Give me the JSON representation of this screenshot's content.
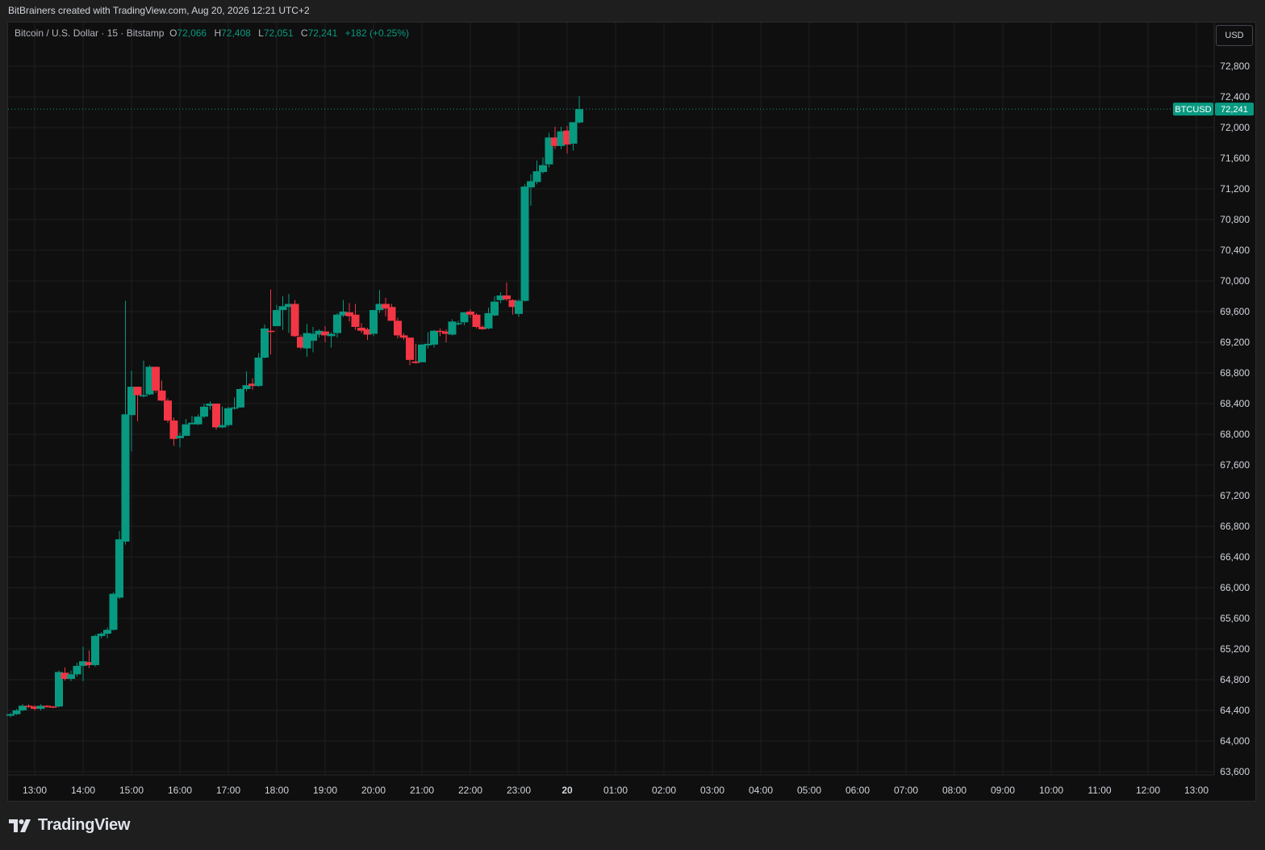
{
  "attribution": "BitBrainers created with TradingView.com, Aug 20, 2026 12:21 UTC+2",
  "legend": {
    "symbol": "Bitcoin / U.S. Dollar · 15 · Bitstamp",
    "open_label": "O",
    "open": "72,066",
    "high_label": "H",
    "high": "72,408",
    "low_label": "L",
    "low": "72,051",
    "close_label": "C",
    "close": "72,241",
    "change": "+182 (+0.25%)"
  },
  "currency_button": "USD",
  "price_tag": {
    "symbol": "BTCUSD",
    "price": "72,241"
  },
  "footer": {
    "logo_text": "TradingView",
    "logo_icon": "tradingview-logo-icon"
  },
  "colors": {
    "up": "#089981",
    "down": "#f23645",
    "background": "#0f0f0f",
    "grid": "#1f1f1f",
    "text": "#d1d4dc"
  },
  "chart_data": {
    "type": "candlestick",
    "interval": "15",
    "ylim": [
      63600,
      73200
    ],
    "y_ticks": [
      "72,800",
      "72,400",
      "72,000",
      "71,600",
      "71,200",
      "70,800",
      "70,400",
      "70,000",
      "69,600",
      "69,200",
      "68,800",
      "68,400",
      "68,000",
      "67,600",
      "67,200",
      "66,800",
      "66,400",
      "66,000",
      "65,600",
      "65,200",
      "64,800",
      "64,400",
      "64,000",
      "63,600"
    ],
    "x_ticks": [
      "13:00",
      "14:00",
      "15:00",
      "16:00",
      "17:00",
      "18:00",
      "19:00",
      "20:00",
      "21:00",
      "22:00",
      "23:00",
      "20",
      "01:00",
      "02:00",
      "03:00",
      "04:00",
      "05:00",
      "06:00",
      "07:00",
      "08:00",
      "09:00",
      "10:00",
      "11:00",
      "12:00",
      "13:00"
    ],
    "last_price": 72241,
    "candles": [
      [
        64330,
        64370,
        64310,
        64350
      ],
      [
        64350,
        64420,
        64340,
        64400
      ],
      [
        64400,
        64480,
        64390,
        64460
      ],
      [
        64460,
        64480,
        64430,
        64450
      ],
      [
        64450,
        64470,
        64400,
        64420
      ],
      [
        64420,
        64480,
        64400,
        64460
      ],
      [
        64460,
        64470,
        64430,
        64450
      ],
      [
        64450,
        64460,
        64430,
        64440
      ],
      [
        64450,
        64920,
        64440,
        64900
      ],
      [
        64890,
        64960,
        64790,
        64810
      ],
      [
        64810,
        64920,
        64780,
        64870
      ],
      [
        64870,
        65020,
        64840,
        64980
      ],
      [
        64980,
        65230,
        64780,
        65040
      ],
      [
        65030,
        65180,
        64950,
        64990
      ],
      [
        64990,
        65390,
        64970,
        65370
      ],
      [
        65370,
        65420,
        65340,
        65400
      ],
      [
        65400,
        65480,
        65340,
        65450
      ],
      [
        65450,
        65940,
        65440,
        65920
      ],
      [
        65870,
        66740,
        65850,
        66630
      ],
      [
        66600,
        69740,
        66560,
        68260
      ],
      [
        68250,
        68830,
        67780,
        68620
      ],
      [
        68620,
        68620,
        68170,
        68510
      ],
      [
        68500,
        68960,
        68480,
        68510
      ],
      [
        68520,
        68900,
        68510,
        68880
      ],
      [
        68880,
        68880,
        68540,
        68570
      ],
      [
        68570,
        68700,
        68430,
        68440
      ],
      [
        68440,
        68470,
        68150,
        68180
      ],
      [
        68180,
        68220,
        67850,
        67940
      ],
      [
        67950,
        68020,
        67830,
        67980
      ],
      [
        67980,
        68200,
        67980,
        68130
      ],
      [
        68130,
        68240,
        68130,
        68150
      ],
      [
        68130,
        68260,
        68120,
        68230
      ],
      [
        68230,
        68400,
        68210,
        68360
      ],
      [
        68370,
        68430,
        68320,
        68400
      ],
      [
        68400,
        68400,
        68060,
        68090
      ],
      [
        68090,
        68360,
        68080,
        68120
      ],
      [
        68120,
        68360,
        68100,
        68340
      ],
      [
        68340,
        68480,
        68320,
        68350
      ],
      [
        68350,
        68600,
        68350,
        68590
      ],
      [
        68590,
        68820,
        68560,
        68640
      ],
      [
        68660,
        68730,
        68580,
        68630
      ],
      [
        68630,
        69060,
        68620,
        69000
      ],
      [
        69000,
        69430,
        68990,
        69380
      ],
      [
        69350,
        69890,
        69040,
        69340
      ],
      [
        69410,
        69690,
        69430,
        69620
      ],
      [
        69620,
        69800,
        69360,
        69670
      ],
      [
        69660,
        69830,
        69320,
        69700
      ],
      [
        69700,
        69750,
        69270,
        69280
      ],
      [
        69270,
        69300,
        69110,
        69130
      ],
      [
        69120,
        69440,
        69010,
        69320
      ],
      [
        69220,
        69400,
        69070,
        69310
      ],
      [
        69300,
        69370,
        69260,
        69350
      ],
      [
        69340,
        69410,
        69200,
        69290
      ],
      [
        69280,
        69330,
        69130,
        69310
      ],
      [
        69320,
        69580,
        69260,
        69560
      ],
      [
        69550,
        69750,
        69530,
        69600
      ],
      [
        69590,
        69710,
        69470,
        69540
      ],
      [
        69560,
        69700,
        69360,
        69400
      ],
      [
        69390,
        69450,
        69320,
        69350
      ],
      [
        69370,
        69390,
        69230,
        69300
      ],
      [
        69310,
        69610,
        69280,
        69620
      ],
      [
        69620,
        69880,
        69580,
        69700
      ],
      [
        69700,
        69780,
        69540,
        69640
      ],
      [
        69660,
        69700,
        69480,
        69480
      ],
      [
        69480,
        69520,
        69250,
        69290
      ],
      [
        69290,
        69320,
        69230,
        69260
      ],
      [
        69260,
        69260,
        68900,
        68970
      ],
      [
        68950,
        69180,
        68920,
        68930
      ],
      [
        68940,
        69180,
        68940,
        69170
      ],
      [
        69160,
        69330,
        69120,
        69180
      ],
      [
        69170,
        69360,
        69130,
        69350
      ],
      [
        69350,
        69380,
        69280,
        69340
      ],
      [
        69340,
        69370,
        69200,
        69310
      ],
      [
        69300,
        69500,
        69290,
        69470
      ],
      [
        69440,
        69480,
        69420,
        69450
      ],
      [
        69460,
        69580,
        69420,
        69590
      ],
      [
        69600,
        69630,
        69520,
        69560
      ],
      [
        69560,
        69580,
        69380,
        69400
      ],
      [
        69400,
        69420,
        69360,
        69370
      ],
      [
        69380,
        69650,
        69370,
        69580
      ],
      [
        69550,
        69800,
        69540,
        69730
      ],
      [
        69750,
        69850,
        69710,
        69810
      ],
      [
        69810,
        69980,
        69740,
        69760
      ],
      [
        69750,
        69760,
        69560,
        69660
      ],
      [
        69570,
        69760,
        69530,
        69740
      ],
      [
        69740,
        71260,
        69730,
        71230
      ],
      [
        71220,
        71390,
        70980,
        71300
      ],
      [
        71290,
        71570,
        71260,
        71430
      ],
      [
        71420,
        71610,
        71400,
        71510
      ],
      [
        71520,
        71930,
        71480,
        71870
      ],
      [
        71870,
        72010,
        71720,
        71760
      ],
      [
        71760,
        72010,
        71720,
        71950
      ],
      [
        71960,
        72020,
        71660,
        71780
      ],
      [
        71790,
        72060,
        71700,
        72070
      ],
      [
        72066,
        72408,
        72051,
        72241
      ]
    ]
  }
}
